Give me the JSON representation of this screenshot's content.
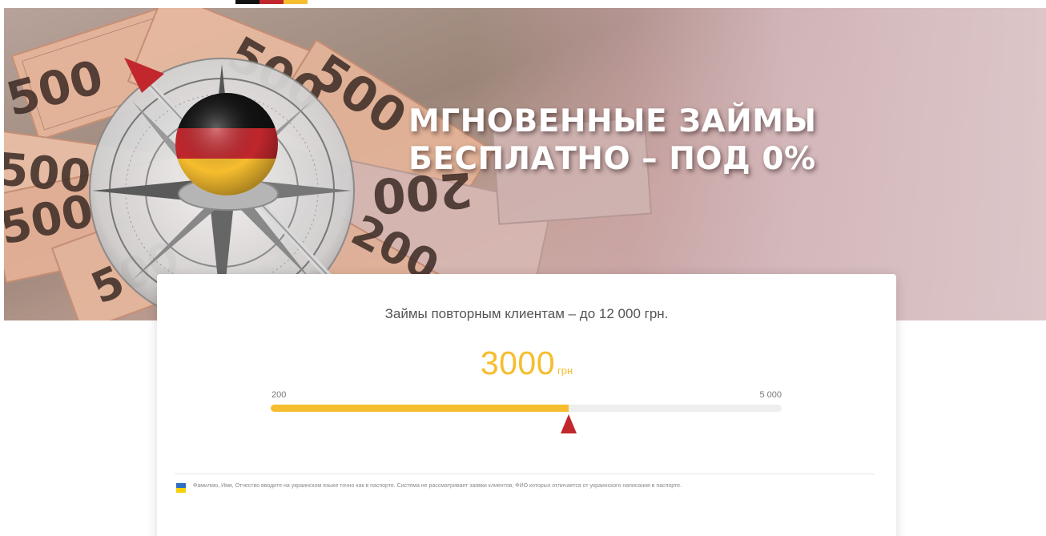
{
  "colors": {
    "accent": "#f6bd2e",
    "handle": "#c1272d",
    "flag_de": [
      "#111111",
      "#c1272d",
      "#f6bd2e"
    ],
    "flag_ua": [
      "#2f6fc4",
      "#f6d10a"
    ]
  },
  "header": {
    "logo_icon": "flag-stripes-logo"
  },
  "hero": {
    "title_line1": "МГНОВЕННЫЕ ЗАЙМЫ",
    "title_line2": "БЕСПЛАТНО – ПОД 0%",
    "image": "compass-with-german-flag-over-hryvnia-banknotes",
    "banknote_numbers": [
      "500",
      "500",
      "500",
      "500",
      "500",
      "500",
      "200",
      "200"
    ]
  },
  "calculator": {
    "subtitle": "Займы повторным клиентам – до 12 000 грн.",
    "amount": "3000",
    "unit": "грн",
    "range_min_label": "200",
    "range_max_label": "5 000",
    "slider": {
      "min": 200,
      "max": 5000,
      "value": 3000
    }
  },
  "notice": {
    "icon": "ukraine-flag-icon",
    "text": "Фамилию, Имя, Отчество вводите на украинском языке точно как в паспорте. Система не рассматривает заявки клиентов, ФИО которых отличается от украинского написания в паспорте."
  }
}
